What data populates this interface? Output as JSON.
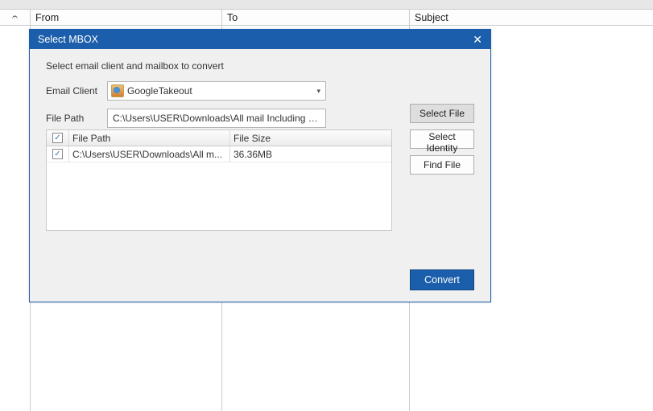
{
  "bg": {
    "columns": {
      "from": "From",
      "to": "To",
      "subject": "Subject"
    }
  },
  "modal": {
    "title": "Select MBOX",
    "instruction": "Select email client and mailbox to convert",
    "labels": {
      "email_client": "Email Client",
      "file_path": "File Path"
    },
    "email_client_value": "GoogleTakeout",
    "file_path_value": "C:\\Users\\USER\\Downloads\\All mail Including Spam and T",
    "buttons": {
      "select_file": "Select File",
      "select_identity": "Select Identity",
      "find_file": "Find File",
      "convert": "Convert"
    },
    "table": {
      "headers": {
        "path": "File Path",
        "size": "File Size"
      },
      "rows": [
        {
          "checked": true,
          "path": "C:\\Users\\USER\\Downloads\\All m...",
          "size": "36.36MB"
        }
      ]
    }
  }
}
